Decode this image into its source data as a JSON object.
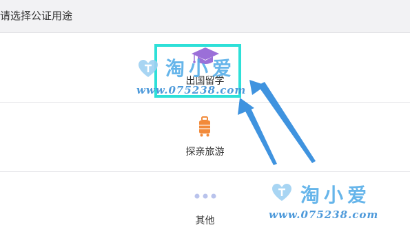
{
  "header": {
    "title": "请选择公证用途"
  },
  "options": [
    {
      "label": "出国留学",
      "icon": "graduation-cap-icon",
      "icon_color": "#9b6fd8"
    },
    {
      "label": "探亲旅游",
      "icon": "luggage-icon",
      "icon_color": "#f28a3a"
    },
    {
      "label": "其他",
      "icon": "more-dots-icon",
      "icon_color": "#b9c3ec"
    }
  ],
  "annotation": {
    "highlight_color": "#2ee0d8",
    "arrow_color": "#3f93df"
  },
  "watermark": [
    {
      "brand": "淘小爱",
      "url": "www.075238.com"
    },
    {
      "brand": "淘小爱",
      "url": "www.075238.com"
    }
  ]
}
